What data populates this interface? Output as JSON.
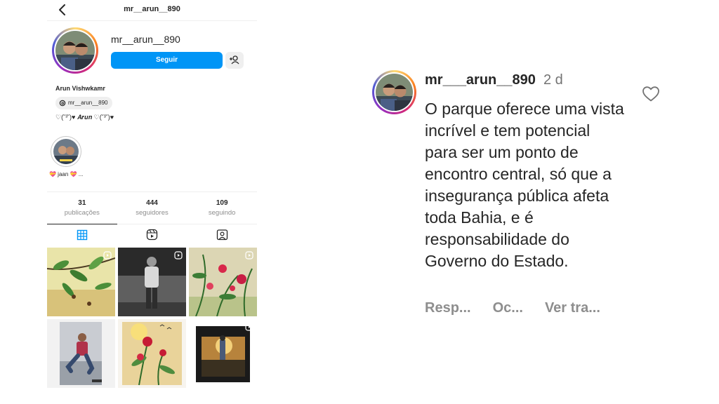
{
  "profile": {
    "top_title": "mr__arun__890",
    "username": "mr__arun__890",
    "follow_label": "Seguir",
    "full_name": "Arun Vishwkamr",
    "threads_handle": "mr__arun__890",
    "bio": "♡(˘³˘)♥ 𝑨𝒓𝒖𝒏 ♡(˘³˘)♥",
    "highlight_label": "💝 jaan 💝 ...",
    "stats": [
      {
        "value": "31",
        "label": "publicações"
      },
      {
        "value": "444",
        "label": "seguidores"
      },
      {
        "value": "109",
        "label": "seguindo"
      }
    ],
    "tabs": [
      "grid-icon",
      "reels-icon",
      "tagged-icon"
    ],
    "posts": [
      {
        "reel": true
      },
      {
        "reel": true
      },
      {
        "reel": true
      },
      {
        "reel": false
      },
      {
        "reel": false
      },
      {
        "reel": true
      }
    ]
  },
  "comment": {
    "username": "mr___arun__890",
    "time": "2 d",
    "text": "O parque oferece uma vista incrível e tem potencial para ser um ponto de encontro central, só que a insegurança pública afeta toda Bahia, e é responsabilidade do Governo do Estado.",
    "actions": [
      "Resp...",
      "Oc...",
      "Ver tra..."
    ]
  },
  "colors": {
    "accent": "#0095f6",
    "text": "#262626",
    "muted": "#8e8e8e"
  }
}
